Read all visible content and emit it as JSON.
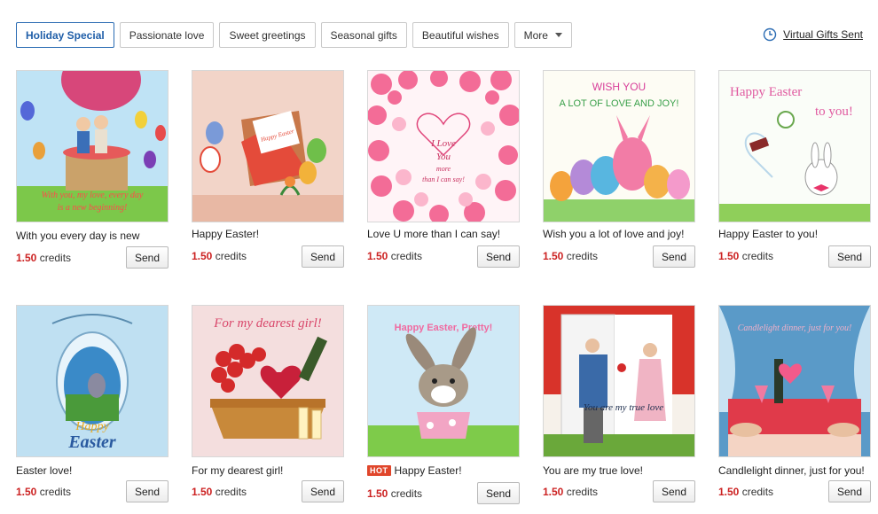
{
  "tabs": [
    {
      "label": "Holiday Special",
      "active": true
    },
    {
      "label": "Passionate love"
    },
    {
      "label": "Sweet greetings"
    },
    {
      "label": "Seasonal gifts"
    },
    {
      "label": "Beautiful wishes"
    },
    {
      "label": "More"
    }
  ],
  "header": {
    "sent_link": "Virtual Gifts Sent",
    "icon": "clock-icon"
  },
  "cards": [
    {
      "title": "With you every day is new",
      "price": "1.50",
      "unit": "credits",
      "button": "Send",
      "image_text": "With you, my love, every day is a new beginning!"
    },
    {
      "title": "Happy Easter!",
      "price": "1.50",
      "unit": "credits",
      "button": "Send",
      "image_text": "Happy Easter my honey girl!"
    },
    {
      "title": "Love U more than I can say!",
      "price": "1.50",
      "unit": "credits",
      "button": "Send",
      "image_text": "I Love You more than I can say!"
    },
    {
      "title": "Wish you a lot of love and joy!",
      "price": "1.50",
      "unit": "credits",
      "button": "Send",
      "image_text": "WISH YOU A LOT OF LOVE AND JOY!"
    },
    {
      "title": "Happy Easter to you!",
      "price": "1.50",
      "unit": "credits",
      "button": "Send",
      "image_text": "Happy Easter to you!"
    },
    {
      "title": "Easter love!",
      "price": "1.50",
      "unit": "credits",
      "button": "Send",
      "image_text": "Happy Easter"
    },
    {
      "title": "For my dearest girl!",
      "price": "1.50",
      "unit": "credits",
      "button": "Send",
      "image_text": "For my dearest girl!"
    },
    {
      "title": "Happy Easter!",
      "price": "1.50",
      "unit": "credits",
      "button": "Send",
      "badge": "HOT",
      "image_text": "Happy Easter, Pretty!"
    },
    {
      "title": "You are my true love!",
      "price": "1.50",
      "unit": "credits",
      "button": "Send",
      "image_text": "You are my true love"
    },
    {
      "title": "Candlelight dinner, just for you!",
      "price": "1.50",
      "unit": "credits",
      "button": "Send",
      "image_text": "Candlelight dinner, just for you!"
    }
  ],
  "colors": {
    "accent": "#1f5ea8",
    "price": "#cc2222",
    "hot_badge": "#e0462b"
  }
}
